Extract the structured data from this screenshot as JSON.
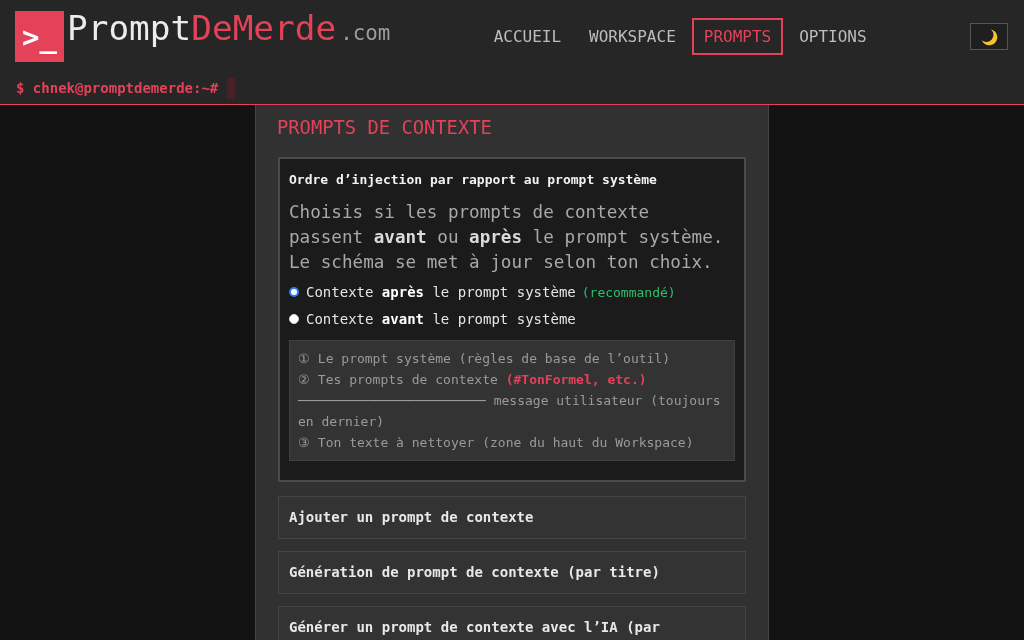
{
  "header": {
    "logo": {
      "mark": ">_",
      "name": "Prompt",
      "name_accent": "DeMerde",
      "domain": ".com"
    },
    "nav": [
      {
        "label": "ACCUEIL",
        "selected": false
      },
      {
        "label": "WORKSPACE",
        "selected": false
      },
      {
        "label": "PROMPTS",
        "selected": true
      },
      {
        "label": "OPTIONS",
        "selected": false
      }
    ],
    "prompt_line": "$ chnek@promptdemerde:~#"
  },
  "section": {
    "title": "PROMPTS DE CONTEXTE",
    "injection_order": {
      "title": "Ordre d’injection par rapport au prompt système",
      "description": "Choisis si les prompts de contexte passent **avant** ou **après** le prompt système. Le schéma se met à jour selon ton choix.",
      "options": [
        {
          "label": "Contexte **après** le prompt système",
          "note": "(recommandé)",
          "selected": true
        },
        {
          "label": "Contexte **avant** le prompt système",
          "selected": false
        }
      ],
      "schema": [
        "① Le prompt système (règles de base de l’outil)",
        "② Tes prompts de contexte **(#TonFormel, etc.)**",
        "──────────────────────── message utilisateur (toujours en dernier)",
        "③ Ton texte à nettoyer (zone du haut du Workspace)"
      ]
    },
    "actions": [
      "Ajouter un prompt de contexte",
      "Génération de prompt de contexte (par titre)",
      "Générer un prompt de contexte avec l’IA (par"
    ]
  }
}
